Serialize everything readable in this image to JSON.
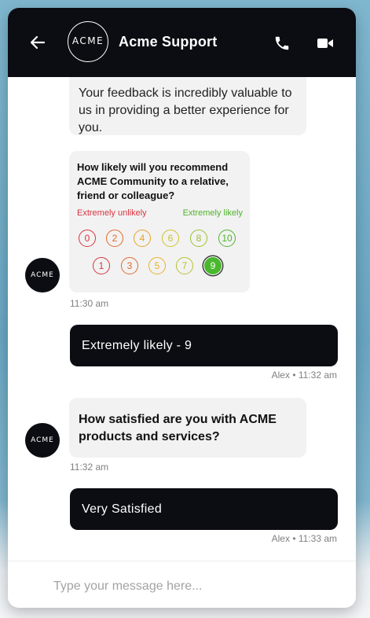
{
  "header": {
    "logo_text": "ACME",
    "title": "Acme Support",
    "icons": {
      "back": "arrow-left-icon",
      "call": "phone-icon",
      "video": "video-camera-icon"
    }
  },
  "messages": {
    "feedback_text": "Your feedback is incredibly valuable to us in providing a better experience for you.",
    "survey": {
      "question": "How likely will you recommend ACME Community to a relative, friend or colleague?",
      "low_label": "Extremely unlikely",
      "high_label": "Extremely likely",
      "selected": 9,
      "options": [
        {
          "label": "0",
          "value": 0,
          "color": "#d8343f"
        },
        {
          "label": "2",
          "value": 2,
          "color": "#e06a2d"
        },
        {
          "label": "4",
          "value": 4,
          "color": "#e8a12a"
        },
        {
          "label": "6",
          "value": 6,
          "color": "#cfc22a"
        },
        {
          "label": "8",
          "value": 8,
          "color": "#98c22c"
        },
        {
          "label": "10",
          "value": 10,
          "color": "#4eb42c"
        },
        {
          "label": "1",
          "value": 1,
          "color": "#d8343f"
        },
        {
          "label": "3",
          "value": 3,
          "color": "#e06a2d"
        },
        {
          "label": "5",
          "value": 5,
          "color": "#e8b12a"
        },
        {
          "label": "7",
          "value": 7,
          "color": "#b6c32b"
        },
        {
          "label": "9",
          "value": 9,
          "color": "#4ab82e"
        }
      ]
    },
    "avatar_text": "ACME",
    "agent_time_1": "11:30 am",
    "user_reply_1": "Extremely likely - 9",
    "user_time_1": "Alex • 11:32 am",
    "agent_question_2": "How satisfied are you with ACME products and services?",
    "agent_time_2": "11:32 am",
    "user_reply_2": "Very Satisfied",
    "user_time_2": "Alex • 11:33 am"
  },
  "input": {
    "placeholder": "Type your message here..."
  },
  "colors": {
    "header_bg": "#0b0d12",
    "user_bubble": "#0b0d12",
    "agent_bubble": "#f2f2f2",
    "selected_rating": "#4ab82e"
  }
}
